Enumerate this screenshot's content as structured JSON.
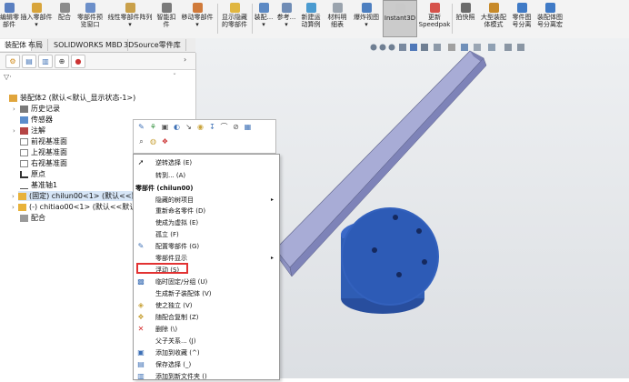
{
  "ribbon": {
    "items": [
      {
        "label": "编辑零\n部件",
        "icon": "edit-component-icon"
      },
      {
        "label": "插入零部件\n▾",
        "icon": "insert-component-icon"
      },
      {
        "label": "配合",
        "icon": "mate-icon"
      },
      {
        "label": "零部件预\n览窗口",
        "icon": "preview-window-icon"
      },
      {
        "label": "线性零部件阵列\n▾",
        "icon": "linear-pattern-icon"
      },
      {
        "label": "智能扣\n件",
        "icon": "smart-fastener-icon"
      },
      {
        "label": "移动零部件\n▾",
        "icon": "move-component-icon"
      },
      {
        "label": "显示隐藏\n的零部件",
        "icon": "show-hidden-icon"
      },
      {
        "label": "装配...\n▾",
        "icon": "assembly-features-icon"
      },
      {
        "label": "参考...\n▾",
        "icon": "reference-geometry-icon"
      },
      {
        "label": "新建运\n动算例",
        "icon": "new-motion-study-icon"
      },
      {
        "label": "材料明\n细表",
        "icon": "bom-icon"
      },
      {
        "label": "爆炸视图\n▾",
        "icon": "exploded-view-icon"
      },
      {
        "label": "Instant3D",
        "icon": "instant3d-icon"
      },
      {
        "label": "更新\nSpeedpak",
        "icon": "speedpak-icon"
      },
      {
        "label": "拍快照",
        "icon": "snapshot-icon"
      },
      {
        "label": "大型装配\n体模式",
        "icon": "large-assembly-icon"
      },
      {
        "label": "零件图\n号分离",
        "icon": "part-number-icon"
      },
      {
        "label": "装配体图\n号分离宏",
        "icon": "assembly-macro-icon"
      }
    ]
  },
  "tabs": [
    "装配体",
    "布局",
    "SOLIDWORKS MBD",
    "3DSource零件库"
  ],
  "tree": {
    "root": "装配体2 (默认<默认_显示状态-1>)",
    "items": [
      {
        "label": "历史记录",
        "icon": "history-icon"
      },
      {
        "label": "传感器",
        "icon": "sensor-icon"
      },
      {
        "label": "注解",
        "icon": "annotation-icon"
      },
      {
        "label": "前视基准面",
        "icon": "plane-icon"
      },
      {
        "label": "上视基准面",
        "icon": "plane-icon"
      },
      {
        "label": "右视基准面",
        "icon": "plane-icon"
      },
      {
        "label": "原点",
        "icon": "origin-icon"
      },
      {
        "label": "基准轴1",
        "icon": "axis-icon"
      },
      {
        "label": "(固定) chilun00<1> (默认<<默",
        "icon": "part-icon"
      },
      {
        "label": "(-) chitiao00<1> (默认<<默认",
        "icon": "part-icon"
      },
      {
        "label": "配合",
        "icon": "mates-folder-icon"
      }
    ]
  },
  "context_menu": {
    "header": "零部件 (chilun00)",
    "items": [
      {
        "label": "逆转选择 (E)",
        "icon": "cursor-icon",
        "submenu": false
      },
      {
        "label": "转到... (A)",
        "icon": "",
        "submenu": false
      },
      {
        "label": "隐藏的树项目",
        "icon": "",
        "submenu": true
      },
      {
        "label": "重新命名零件 (D)",
        "icon": "",
        "submenu": false
      },
      {
        "label": "使成为虚拟 (E)",
        "icon": "",
        "submenu": false
      },
      {
        "label": "孤立 (F)",
        "icon": "",
        "submenu": false
      },
      {
        "label": "配置零部件 (G)",
        "icon": "configure-icon",
        "submenu": false
      },
      {
        "label": "零部件显示",
        "icon": "",
        "submenu": true
      },
      {
        "label": "浮动 (S)",
        "icon": "",
        "submenu": false
      },
      {
        "label": "临时固定/分组 (U)",
        "icon": "fix-group-icon",
        "submenu": false
      },
      {
        "label": "生成新子装配体 (V)",
        "icon": "",
        "submenu": false
      },
      {
        "label": "使之独立 (V)",
        "icon": "independent-icon",
        "submenu": false
      },
      {
        "label": "随配合复制 (Z)",
        "icon": "copy-mates-icon",
        "submenu": false
      },
      {
        "label": "删除 (\\)",
        "icon": "delete-icon",
        "submenu": false
      },
      {
        "label": "父子关系... (J)",
        "icon": "",
        "submenu": false
      },
      {
        "label": "添加到收藏 (^)",
        "icon": "favorite-icon",
        "submenu": false
      },
      {
        "label": "保存选择 (_)",
        "icon": "save-selection-icon",
        "submenu": false
      },
      {
        "label": "添加到新文件夹 ()",
        "icon": "new-folder-icon",
        "submenu": false
      }
    ]
  },
  "colors": {
    "ribbon_bg": "#f3f3f3",
    "viewport_bg": "#e4e7ea",
    "gear": "#2f5db4",
    "bar": "#a8acd6",
    "highlight_box": "#e23232"
  }
}
